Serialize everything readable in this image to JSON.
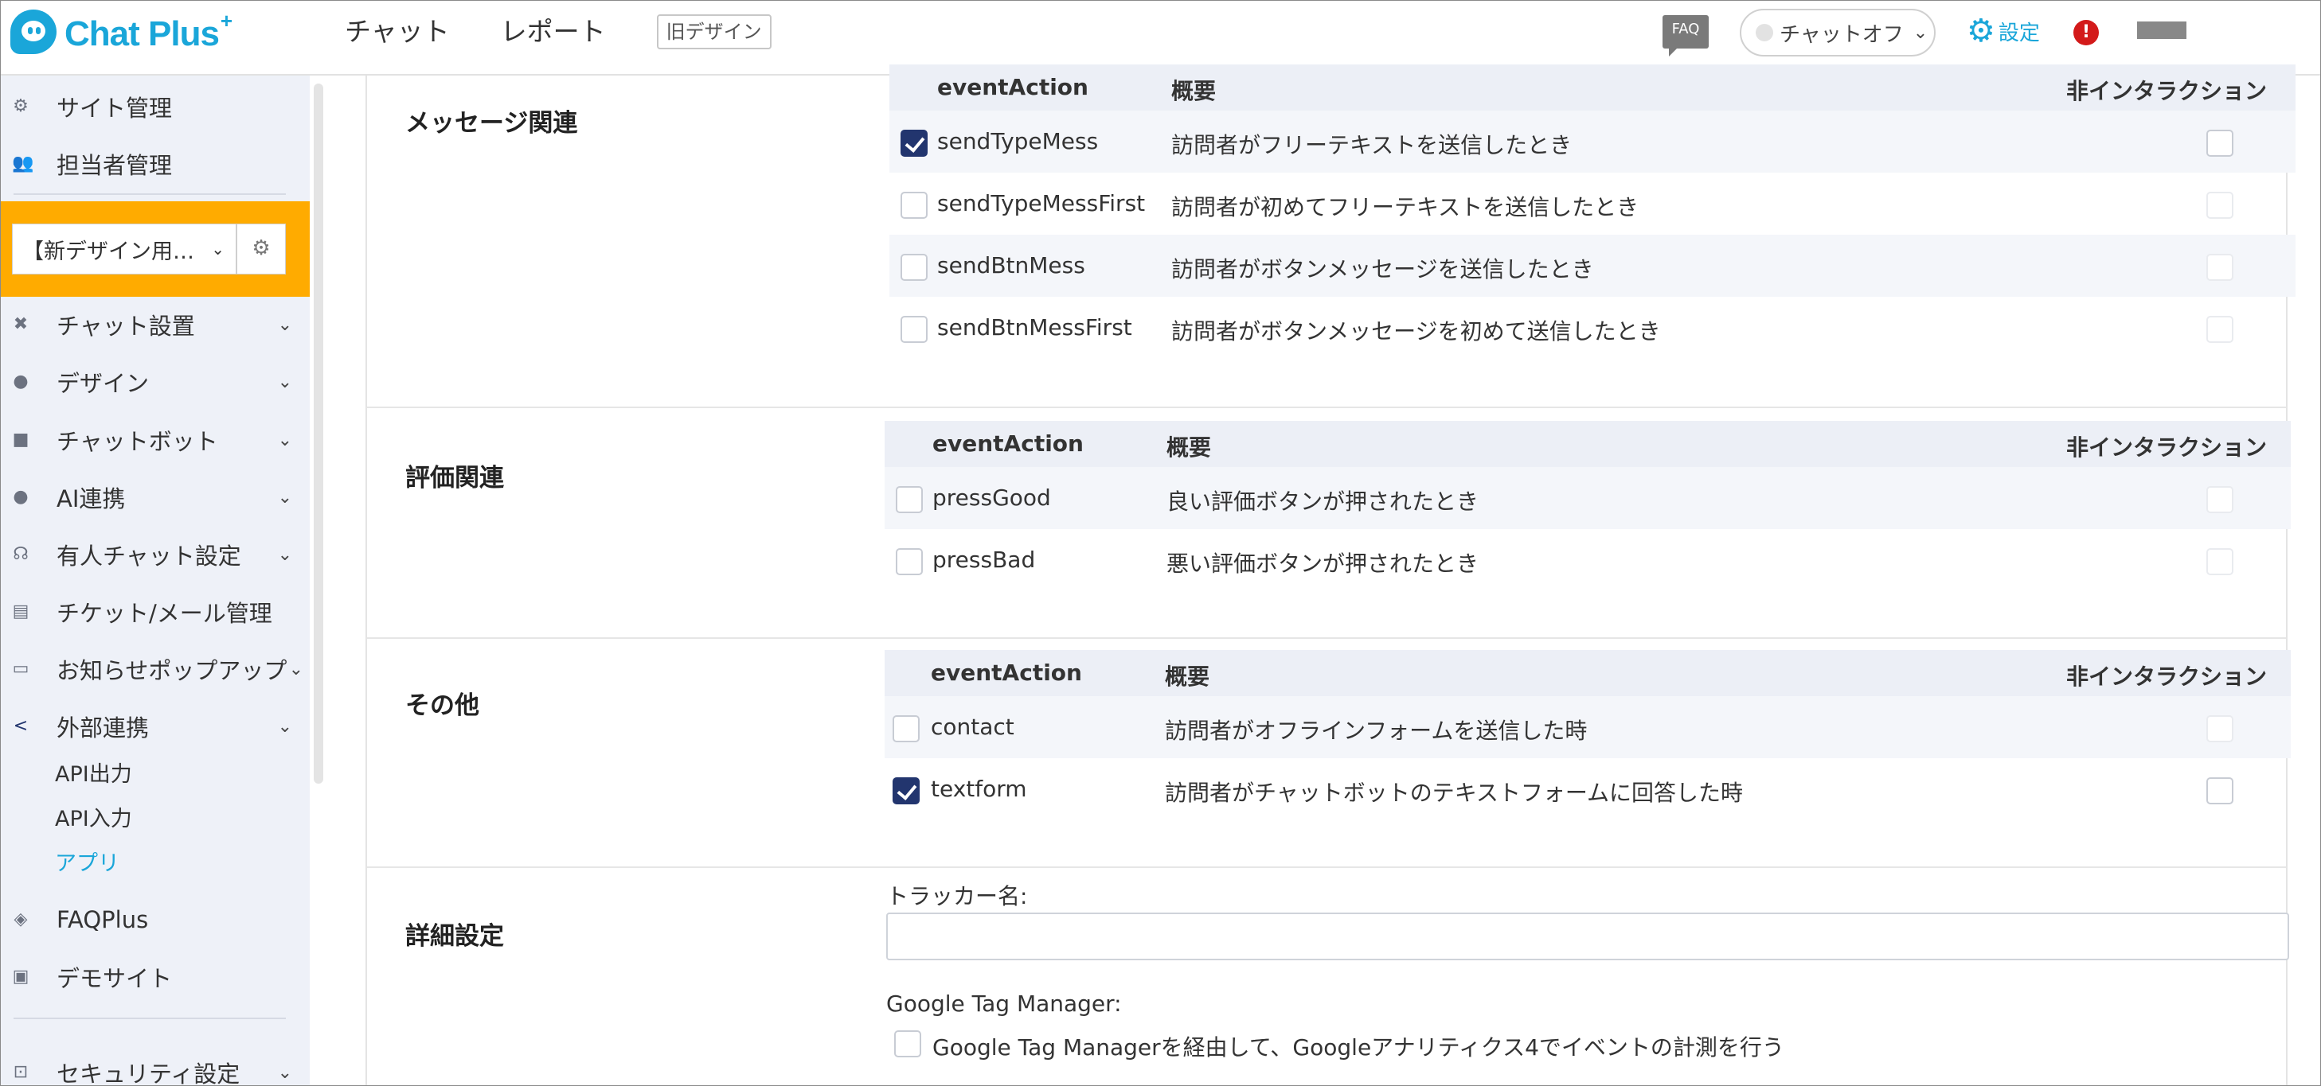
{
  "header": {
    "logo_text": "Chat Plus",
    "logo_sup": "+",
    "nav": [
      "チャット",
      "レポート"
    ],
    "old_design": "旧デザイン",
    "faq_label": "FAQ",
    "chat_status": "チャットオフ",
    "settings_label": "設定",
    "alert": "!"
  },
  "sidebar": {
    "top_items": [
      {
        "label": "サイト管理",
        "icon": "gear-icon"
      },
      {
        "label": "担当者管理",
        "icon": "users-icon"
      }
    ],
    "site_selector": "【新デザイン用…",
    "items": [
      {
        "label": "チャット設置",
        "icon": "tools-icon"
      },
      {
        "label": "デザイン",
        "icon": "palette-icon"
      },
      {
        "label": "チャットボット",
        "icon": "chat-icon"
      },
      {
        "label": "AI連携",
        "icon": "ai-icon"
      },
      {
        "label": "有人チャット設定",
        "icon": "headset-icon"
      },
      {
        "label": "チケット/メール管理",
        "icon": "ticket-icon"
      },
      {
        "label": "お知らせポップアップ",
        "icon": "popup-icon"
      },
      {
        "label": "外部連携",
        "icon": "share-icon"
      }
    ],
    "sub_items": [
      "API出力",
      "API入力",
      "アプリ"
    ],
    "bottom_items": [
      {
        "label": "FAQPlus",
        "icon": "shield-icon"
      },
      {
        "label": "デモサイト",
        "icon": "monitor-icon"
      },
      {
        "label": "セキュリティ設定",
        "icon": "lock-icon"
      }
    ]
  },
  "main": {
    "col_event": "eventAction",
    "col_desc": "概要",
    "col_noninteraction": "非インタラクション",
    "sections": [
      {
        "title": "メッセージ関連",
        "rows": [
          {
            "event": "sendTypeMess",
            "desc": "訪問者がフリーテキストを送信したとき",
            "checked": true,
            "nonint_checked": false
          },
          {
            "event": "sendTypeMessFirst",
            "desc": "訪問者が初めてフリーテキストを送信したとき",
            "checked": false,
            "nonint_checked": false
          },
          {
            "event": "sendBtnMess",
            "desc": "訪問者がボタンメッセージを送信したとき",
            "checked": false,
            "nonint_checked": false
          },
          {
            "event": "sendBtnMessFirst",
            "desc": "訪問者がボタンメッセージを初めて送信したとき",
            "checked": false,
            "nonint_checked": false
          }
        ]
      },
      {
        "title": "評価関連",
        "rows": [
          {
            "event": "pressGood",
            "desc": "良い評価ボタンが押されたとき",
            "checked": false,
            "nonint_checked": false
          },
          {
            "event": "pressBad",
            "desc": "悪い評価ボタンが押されたとき",
            "checked": false,
            "nonint_checked": false
          }
        ]
      },
      {
        "title": "その他",
        "rows": [
          {
            "event": "contact",
            "desc": "訪問者がオフラインフォームを送信した時",
            "checked": false,
            "nonint_checked": false
          },
          {
            "event": "textform",
            "desc": "訪問者がチャットボットのテキストフォームに回答した時",
            "checked": true,
            "nonint_checked": false
          }
        ]
      }
    ],
    "details": {
      "title": "詳細設定",
      "tracker_label": "トラッカー名:",
      "tracker_value": "",
      "gtm_label": "Google Tag Manager:",
      "gtm_option": "Google Tag Managerを経由して、Googleアナリティクス4でイベントの計測を行う",
      "gtm_checked": false
    }
  },
  "colors": {
    "brand": "#1aa6d9",
    "selector_bg": "#ffab00",
    "checkbox_checked": "#22356e",
    "sidebar_bg": "#eef1f8",
    "alert": "#d31a1a"
  }
}
